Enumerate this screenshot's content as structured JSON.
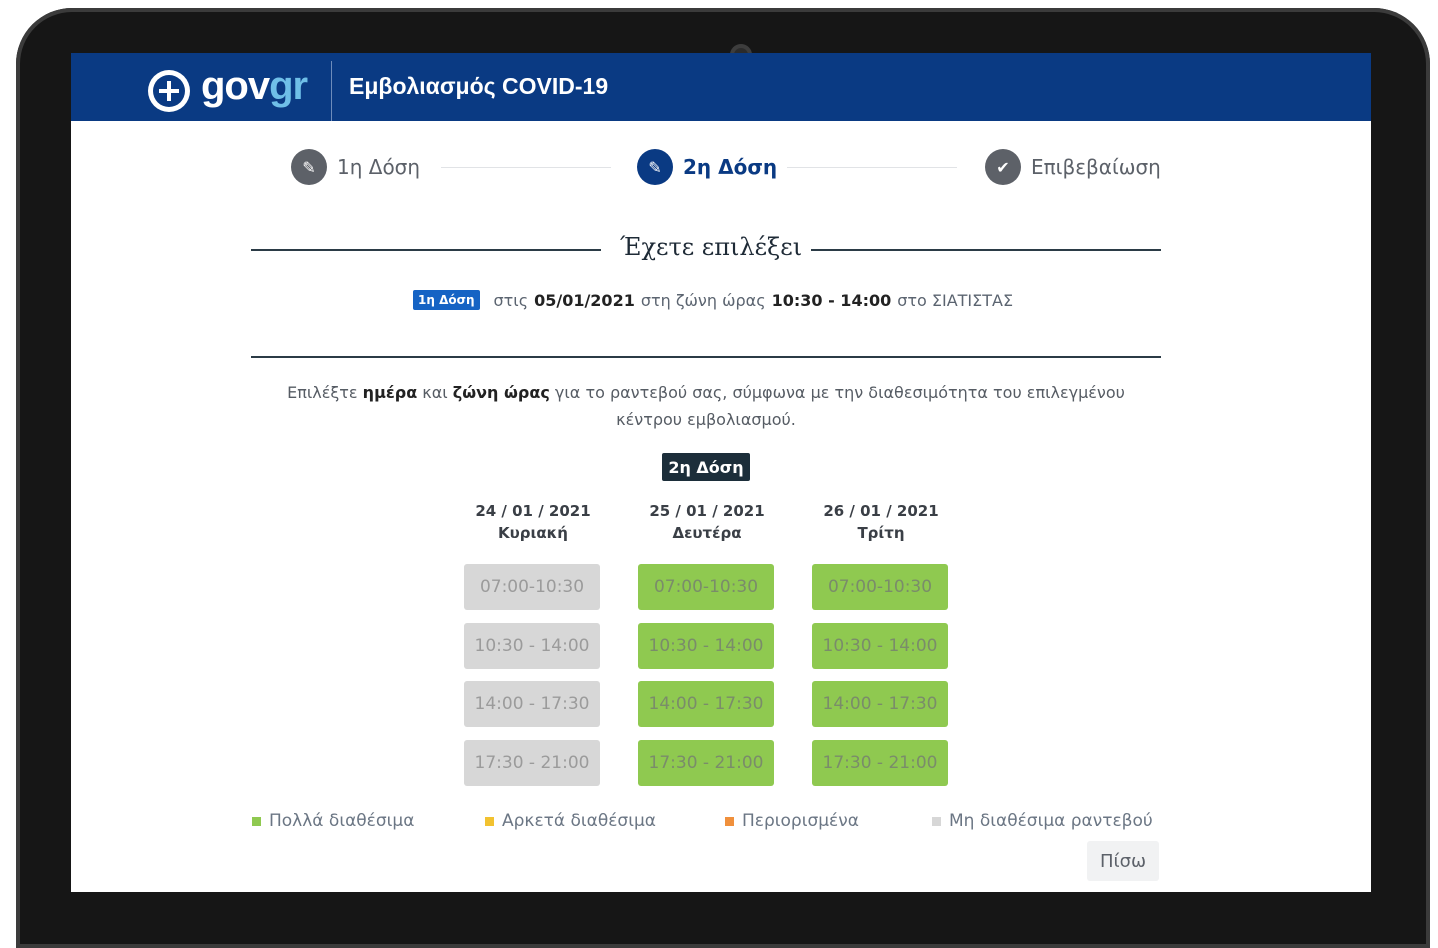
{
  "header": {
    "logo_prefix": "gov",
    "logo_suffix": "gr",
    "title": "Εμβολιασμός COVID-19"
  },
  "steps": [
    {
      "label": "1η Δόση",
      "icon": "pencil-icon",
      "active": false
    },
    {
      "label": "2η Δόση",
      "icon": "pencil-icon",
      "active": true
    },
    {
      "label": "Επιβεβαίωση",
      "icon": "check-icon",
      "active": false
    }
  ],
  "summary": {
    "heading": "Έχετε επιλέξει",
    "badge": "1η Δόση",
    "prefix": "στις",
    "date": "05/01/2021",
    "zone_text": "στη ζώνη ώρας",
    "time": "10:30 - 14:00",
    "center_text": "στο ΣΙΑΤΙΣΤΑΣ"
  },
  "instruction": {
    "part1": "Επιλέξτε",
    "bold1": "ημέρα",
    "part2": "και",
    "bold2": "ζώνη ώρας",
    "part3": "για το ραντεβού σας, σύμφωνα με την διαθεσιμότητα του επιλεγμένου κέντρου εμβολιασμού."
  },
  "dose_badge": "2η Δόση",
  "days": [
    {
      "date": "24 / 01 / 2021",
      "name": "Κυριακή",
      "slots": [
        {
          "time": "07:00-10:30",
          "status": "unavailable"
        },
        {
          "time": "10:30 - 14:00",
          "status": "unavailable"
        },
        {
          "time": "14:00 - 17:30",
          "status": "unavailable"
        },
        {
          "time": "17:30 - 21:00",
          "status": "unavailable"
        }
      ]
    },
    {
      "date": "25 / 01 / 2021",
      "name": "Δευτέρα",
      "slots": [
        {
          "time": "07:00-10:30",
          "status": "many"
        },
        {
          "time": "10:30 - 14:00",
          "status": "many"
        },
        {
          "time": "14:00 - 17:30",
          "status": "many"
        },
        {
          "time": "17:30 - 21:00",
          "status": "many"
        }
      ]
    },
    {
      "date": "26 / 01 / 2021",
      "name": "Τρίτη",
      "slots": [
        {
          "time": "07:00-10:30",
          "status": "many"
        },
        {
          "time": "10:30 - 14:00",
          "status": "many"
        },
        {
          "time": "14:00 - 17:30",
          "status": "many"
        },
        {
          "time": "17:30 - 21:00",
          "status": "many"
        }
      ]
    }
  ],
  "legend": [
    {
      "label": "Πολλά διαθέσιμα",
      "color": "#8fc950"
    },
    {
      "label": "Αρκετά διαθέσιμα",
      "color": "#f2c230"
    },
    {
      "label": "Περιορισμένα",
      "color": "#f0903c"
    },
    {
      "label": "Μη διαθέσιμα ραντεβού",
      "color": "#d7d7d7"
    }
  ],
  "back_label": "Πίσω",
  "colors": {
    "brand": "#0a3a83",
    "logo_accent": "#6fbfe8",
    "available": "#8fc950",
    "unavailable": "#d7d7d7"
  }
}
